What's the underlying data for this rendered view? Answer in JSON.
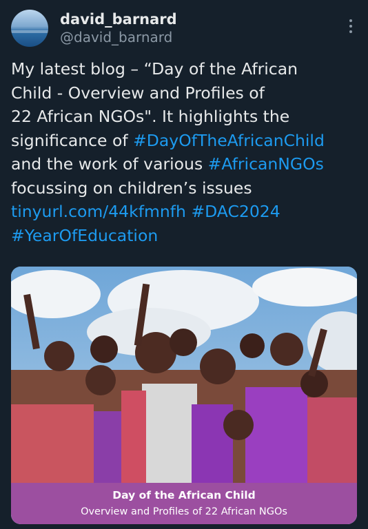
{
  "author": {
    "display_name": "david_barnard",
    "handle": "@david_barnard"
  },
  "post": {
    "lines": [
      [
        {
          "text": "My latest blog – “Day of the African",
          "link": false
        }
      ],
      [
        {
          "text": "Child - Overview and Profiles of",
          "link": false
        }
      ],
      [
        {
          "text": "22 African NGOs\". It highlights the",
          "link": false
        }
      ],
      [
        {
          "text": "significance of ",
          "link": false
        },
        {
          "text": "#DayOfTheAfricanChild",
          "link": true
        }
      ],
      [
        {
          "text": "and the work of various ",
          "link": false
        },
        {
          "text": "#AfricanNGOs",
          "link": true
        }
      ],
      [
        {
          "text": "focussing on children’s issues",
          "link": false
        }
      ],
      [
        {
          "text": "tinyurl.com/44kfmnfh",
          "link": true
        },
        {
          "text": " ",
          "link": false
        },
        {
          "text": "#DAC2024",
          "link": true
        }
      ],
      [
        {
          "text": "#YearOfEducation",
          "link": true
        }
      ]
    ]
  },
  "media_card": {
    "title": "Day of the African Child",
    "subtitle": "Overview and Profiles of 22 African NGOs"
  },
  "colors": {
    "background": "#15202b",
    "text": "#e7e9ea",
    "muted": "#8b98a5",
    "link": "#1d9bf0",
    "caption_bg": "#9c4fa0"
  },
  "icons": {
    "more": "more-vertical-icon"
  }
}
